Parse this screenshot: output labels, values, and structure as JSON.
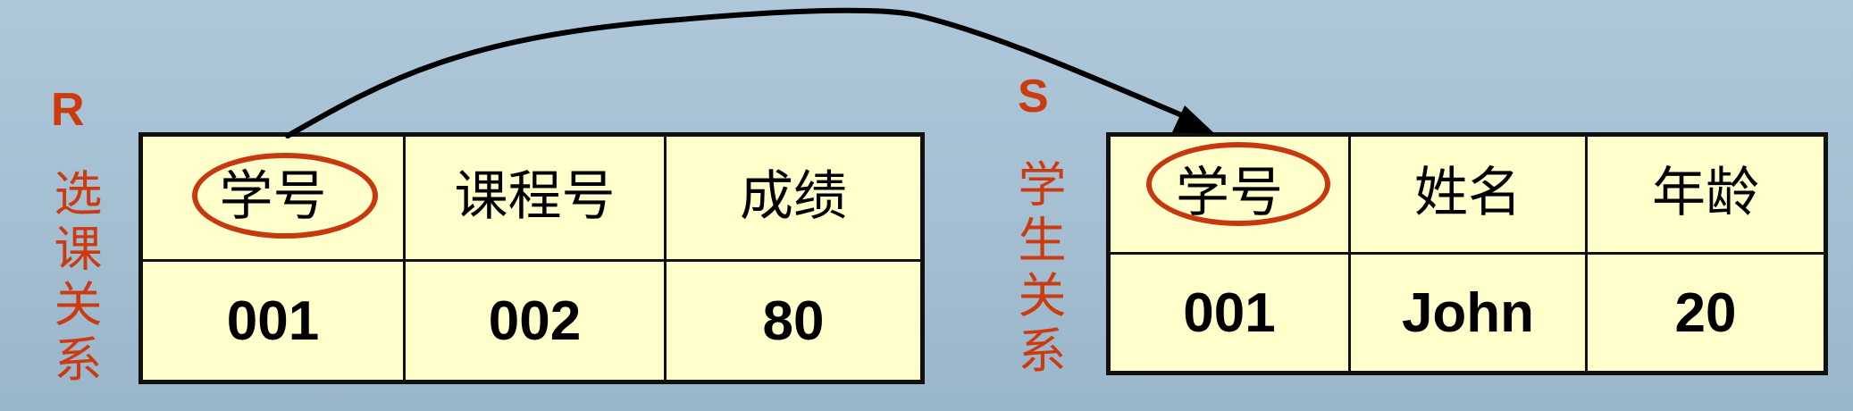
{
  "relations": {
    "r": {
      "letter": "R",
      "name": "选课关系",
      "headers": [
        "学号",
        "课程号",
        "成绩"
      ],
      "row": [
        "001",
        "002",
        "80"
      ]
    },
    "s": {
      "letter": "S",
      "name": "学生关系",
      "headers": [
        "学号",
        "姓名",
        "年龄"
      ],
      "row": [
        "001",
        "John",
        "20"
      ]
    }
  },
  "colors": {
    "accent": "#cc3a10",
    "table_fill": "#ffffcc",
    "border": "#111111",
    "background": "#a8c2d5"
  }
}
